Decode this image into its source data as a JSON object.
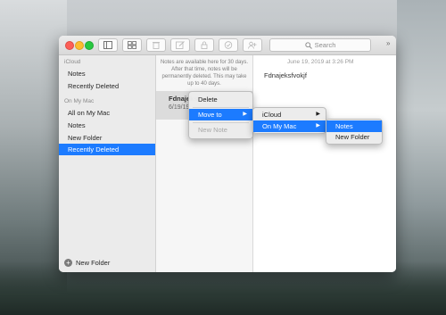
{
  "toolbar": {
    "search_placeholder": "Search",
    "overflow_glyph": "»"
  },
  "sidebar": {
    "sections": [
      {
        "label": "iCloud",
        "items": [
          "Notes",
          "Recently Deleted"
        ]
      },
      {
        "label": "On My Mac",
        "items": [
          "All on My Mac",
          "Notes",
          "New Folder",
          "Recently Deleted"
        ]
      }
    ],
    "selected_item": "Recently Deleted",
    "new_folder_label": "New Folder"
  },
  "list": {
    "notice": "Notes are available here for 30 days. After that time, notes will be permanently deleted. This may take up to 40 days.",
    "note": {
      "title": "Fdnajeksfvokjf",
      "date": "6/19/19"
    }
  },
  "editor": {
    "date": "June 19, 2019 at 3:26 PM",
    "text": "Fdnajeksfvokjf"
  },
  "context_menu": {
    "items": [
      {
        "label": "Delete",
        "enabled": true
      },
      {
        "label": "Move to",
        "enabled": true,
        "highlighted": true,
        "submenu": true
      },
      {
        "label": "New Note",
        "enabled": false
      }
    ]
  },
  "move_to_menu": {
    "items": [
      {
        "label": "iCloud",
        "submenu": true
      },
      {
        "label": "On My Mac",
        "submenu": true,
        "highlighted": true
      }
    ]
  },
  "folder_menu": {
    "items": [
      {
        "label": "Notes",
        "highlighted": true
      },
      {
        "label": "New Folder"
      }
    ]
  },
  "colors": {
    "accent": "#1c7bff"
  }
}
